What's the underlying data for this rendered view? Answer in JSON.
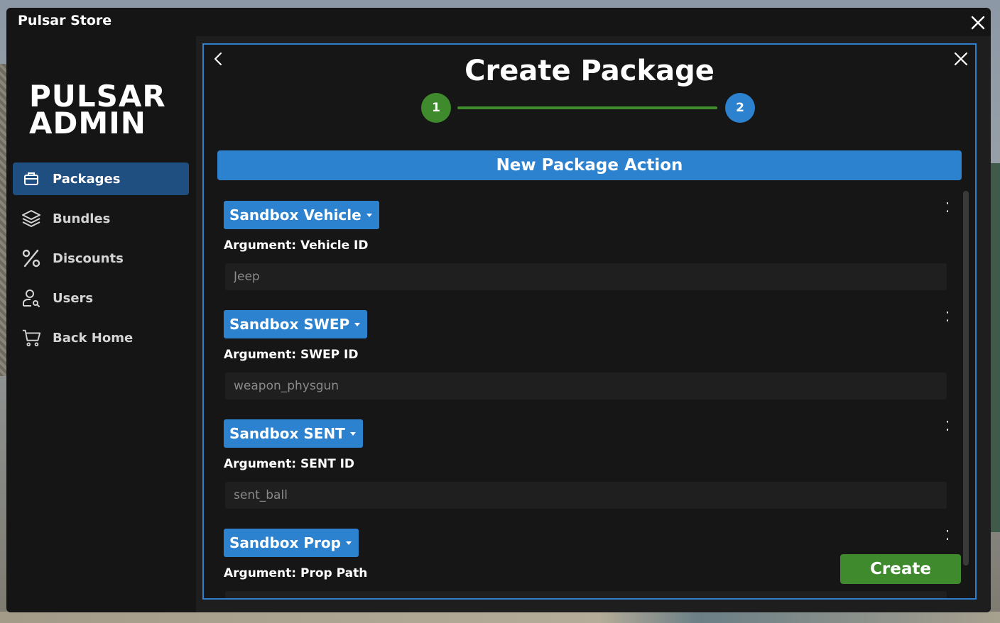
{
  "window": {
    "title": "Pulsar Store"
  },
  "sidebar": {
    "logo_line1": "PULSAR",
    "logo_line2": "ADMIN",
    "items": [
      {
        "label": "Packages",
        "icon": "package-icon",
        "active": true
      },
      {
        "label": "Bundles",
        "icon": "layers-icon",
        "active": false
      },
      {
        "label": "Discounts",
        "icon": "percent-icon",
        "active": false
      },
      {
        "label": "Users",
        "icon": "user-search-icon",
        "active": false
      },
      {
        "label": "Back Home",
        "icon": "cart-icon",
        "active": false
      }
    ]
  },
  "modal": {
    "title": "Create Package",
    "steps": [
      "1",
      "2"
    ],
    "section_header": "New Package Action",
    "actions": [
      {
        "type": "Sandbox Vehicle",
        "argument_label": "Argument: Vehicle ID",
        "value": "Jeep"
      },
      {
        "type": "Sandbox SWEP",
        "argument_label": "Argument: SWEP ID",
        "value": "weapon_physgun"
      },
      {
        "type": "Sandbox SENT",
        "argument_label": "Argument: SENT ID",
        "value": "sent_ball"
      },
      {
        "type": "Sandbox Prop",
        "argument_label": "Argument: Prop Path",
        "value": ""
      }
    ],
    "create_label": "Create"
  },
  "colors": {
    "accent_blue": "#2d82d0",
    "active_nav": "#1f4f80",
    "success_green": "#3e8a2c",
    "background": "#151515"
  }
}
